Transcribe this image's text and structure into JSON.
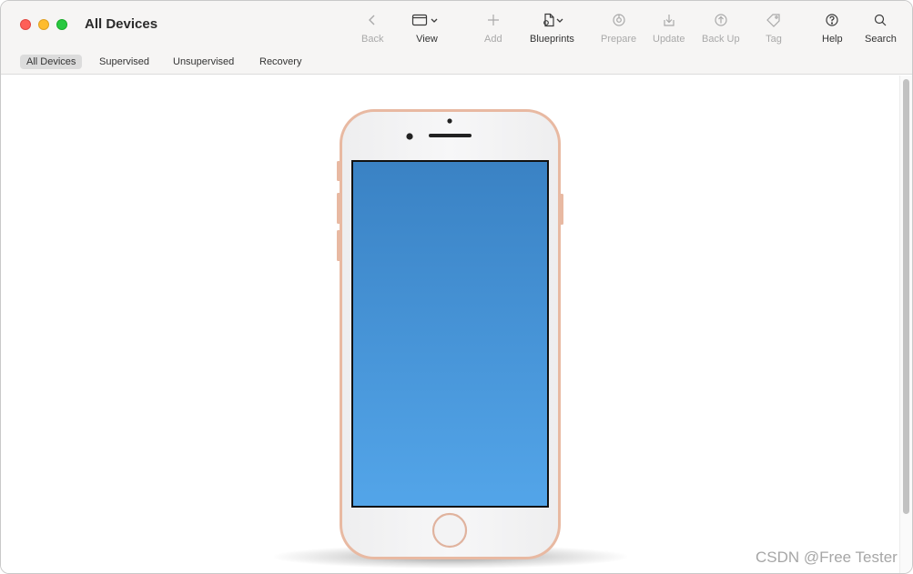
{
  "window": {
    "title": "All Devices"
  },
  "toolbar": {
    "back": "Back",
    "view": "View",
    "add": "Add",
    "blueprints": "Blueprints",
    "prepare": "Prepare",
    "update": "Update",
    "back_up": "Back Up",
    "tag": "Tag",
    "help": "Help",
    "search": "Search"
  },
  "scope": {
    "items": [
      "All Devices",
      "Supervised",
      "Unsupervised",
      "Recovery"
    ],
    "active": "All Devices"
  },
  "device": {
    "frame_color": "#e8b9a2",
    "screen_color_top": "#3a82c4",
    "screen_color_bottom": "#53a5e9"
  },
  "watermark": "CSDN @Free Tester"
}
